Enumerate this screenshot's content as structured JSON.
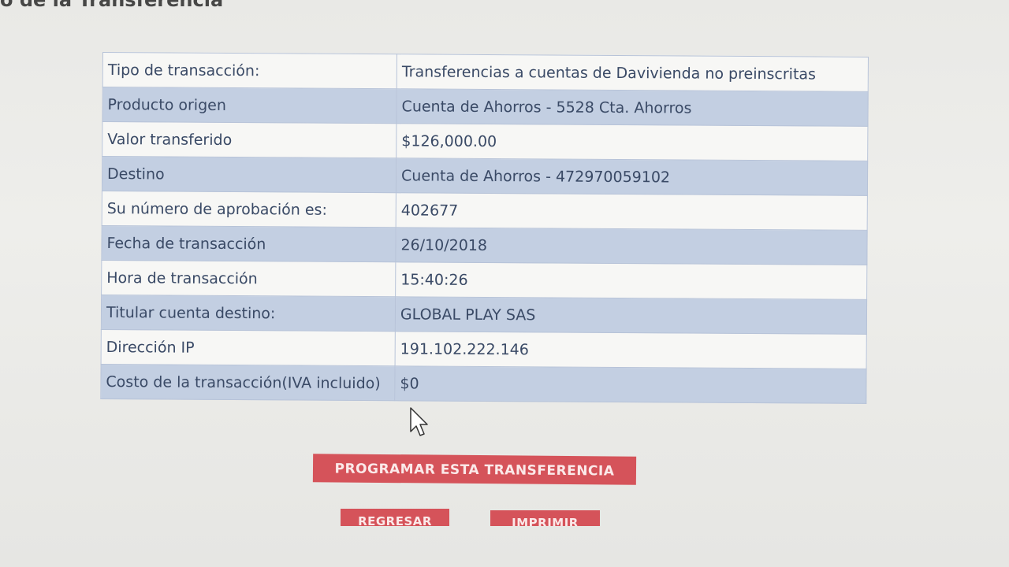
{
  "page": {
    "title": "o de la Transferencia"
  },
  "details": {
    "rows": [
      {
        "label": "Tipo de transacción:",
        "value": "Transferencias a cuentas de Davivienda no preinscritas"
      },
      {
        "label": "Producto origen",
        "value": "Cuenta de Ahorros - 5528 Cta. Ahorros"
      },
      {
        "label": "Valor transferido",
        "value": "$126,000.00"
      },
      {
        "label": "Destino",
        "value": "Cuenta de Ahorros - 472970059102"
      },
      {
        "label": "Su número de aprobación es:",
        "value": "402677"
      },
      {
        "label": "Fecha de transacción",
        "value": "26/10/2018"
      },
      {
        "label": "Hora de transacción",
        "value": "15:40:26"
      },
      {
        "label": "Titular cuenta destino:",
        "value": "GLOBAL PLAY SAS"
      },
      {
        "label": "Dirección IP",
        "value": "191.102.222.146"
      },
      {
        "label": "Costo de la transacción(IVA incluido)",
        "value": "$0"
      }
    ]
  },
  "actions": {
    "program_label": "PROGRAMAR ESTA TRANSFERENCIA",
    "back_label": "REGRESAR",
    "print_label": "IMPRIMIR"
  },
  "colors": {
    "row_alt": "#c3cfe2",
    "row_plain": "#f7f7f5",
    "button": "#d5535a",
    "text": "#3a4a66"
  }
}
